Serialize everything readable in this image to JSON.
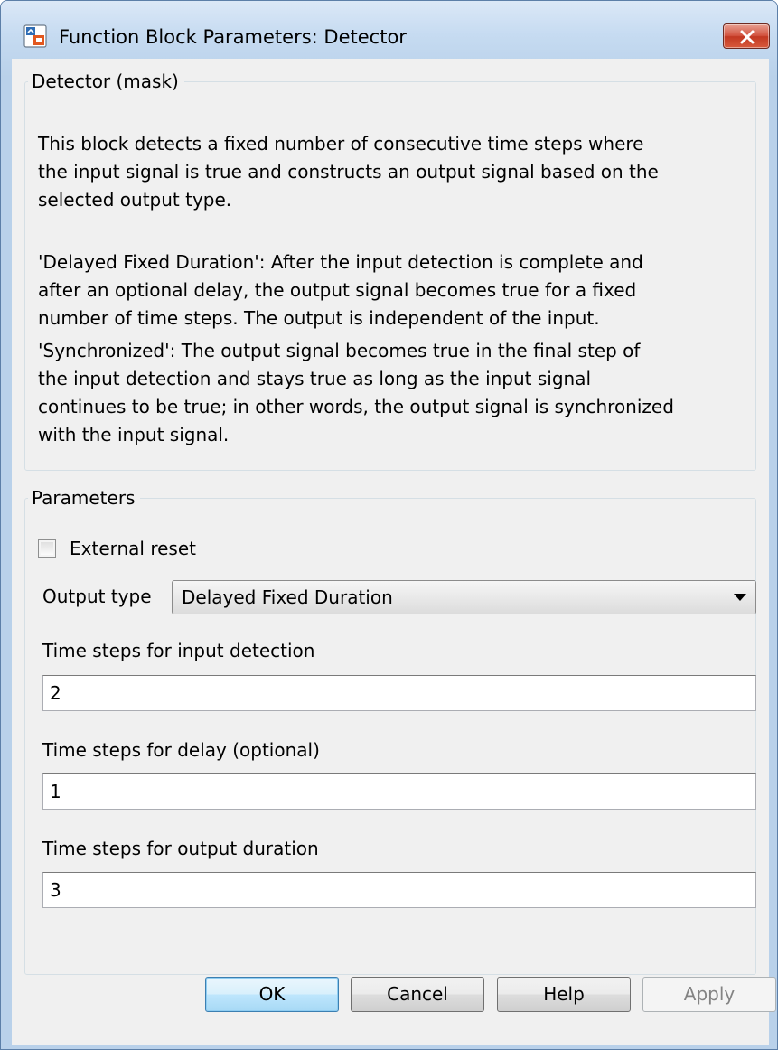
{
  "window": {
    "title": "Function Block Parameters: Detector",
    "close_icon": "close-icon",
    "app_icon": "simulink-block-icon"
  },
  "mask_group": {
    "title": "Detector (mask)",
    "paragraphs": [
      "This block detects a fixed number of consecutive time steps where\nthe input signal is true and constructs an output signal based on the\nselected output type.",
      "'Delayed Fixed Duration': After the input detection is complete and\nafter an optional delay, the output signal becomes true for a fixed\nnumber of time steps. The output is independent of the input.",
      "'Synchronized': The output signal becomes true in the final step of\nthe input detection and stays true as long as the input signal\ncontinues to be true; in other words, the output signal is synchronized\nwith the input signal."
    ]
  },
  "parameters_group": {
    "title": "Parameters",
    "external_reset": {
      "label": "External reset",
      "checked": false
    },
    "output_type": {
      "label": "Output type",
      "value": "Delayed Fixed Duration"
    },
    "input_detection": {
      "label": "Time steps for input detection",
      "value": "2"
    },
    "delay": {
      "label": "Time steps for delay (optional)",
      "value": "1"
    },
    "output_duration": {
      "label": "Time steps for output duration",
      "value": "3"
    }
  },
  "buttons": {
    "ok": "OK",
    "cancel": "Cancel",
    "help": "Help",
    "apply": "Apply"
  },
  "colors": {
    "frame": "#b9d1ea",
    "client": "#f0f0f0",
    "close_button": "#c23822",
    "default_button": "#3c7fb1",
    "disabled_text": "#838383"
  }
}
